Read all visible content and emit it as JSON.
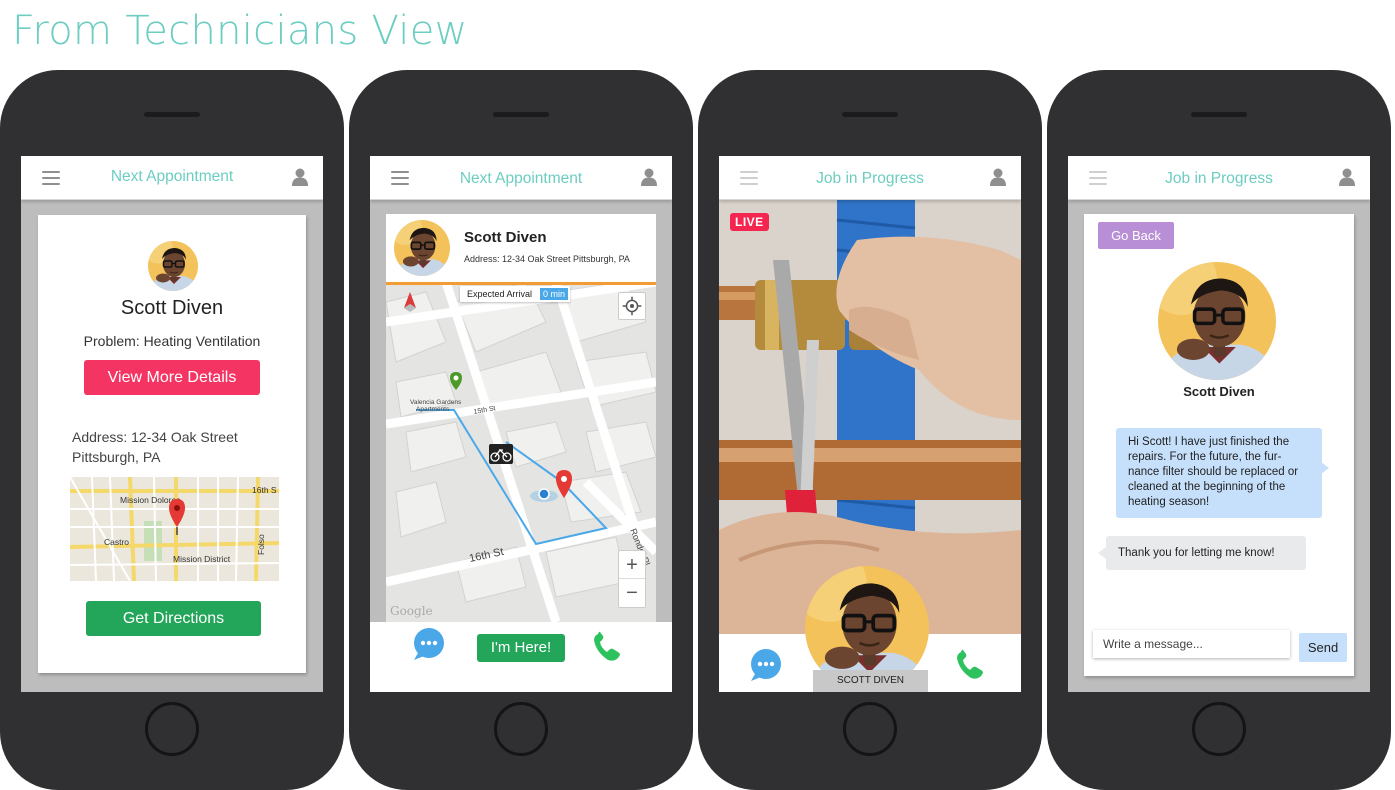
{
  "page": {
    "title": "From Technicians View"
  },
  "colors": {
    "teal": "#6ccdc1",
    "pink": "#f43564",
    "green": "#23a55a",
    "purple": "#b88fd6",
    "blue_bubble": "#c6e0fb",
    "live_red": "#f4264f",
    "phone_body": "#303033"
  },
  "icons": {
    "menu": "hamburger-icon",
    "user": "user-icon",
    "chat": "chat-bubble-icon",
    "call": "phone-icon",
    "locate": "crosshair-icon"
  },
  "screen1": {
    "title": "Next Appointment",
    "name": "Scott Diven",
    "problem": "Problem: Heating Ventilation",
    "details_button": "View More Details",
    "address_line1": "Address: 12-34 Oak Street",
    "address_line2": "Pittsburgh, PA",
    "map_labels": {
      "mission_dolores": "Mission Dolores",
      "street_16th": "16th S",
      "castro": "Castro",
      "mission_district": "Mission District",
      "folsom": "Folso"
    },
    "directions_button": "Get Directions"
  },
  "screen2": {
    "title": "Next Appointment",
    "name": "Scott Diven",
    "address": "Address: 12-34 Oak Street Pittsburgh, PA",
    "eta_label": "Expected Arrival",
    "eta_value": "0 min",
    "map_labels": {
      "valencia": "Valencia Gardens",
      "apartments": "Apartments",
      "street_15th": "15th St",
      "street_16th": "16th St",
      "rondel": "Rondel Pl",
      "google": "Google"
    },
    "zoom_in": "+",
    "zoom_out": "−",
    "here_button": "I'm Here!"
  },
  "screen3": {
    "title": "Job in Progress",
    "live_badge": "LIVE",
    "caller_name": "SCOTT DIVEN"
  },
  "screen4": {
    "title": "Job in Progress",
    "back_button": "Go Back",
    "name": "Scott Diven",
    "messages": [
      {
        "from": "technician",
        "text": "Hi Scott! I have just finished the repairs. For the future, the fur-nance filter should be replaced or cleaned at the beginning of the heating season!"
      },
      {
        "from": "customer",
        "text": "Thank you for letting me know!"
      }
    ],
    "input_placeholder": "Write a message...",
    "send_button": "Send"
  }
}
